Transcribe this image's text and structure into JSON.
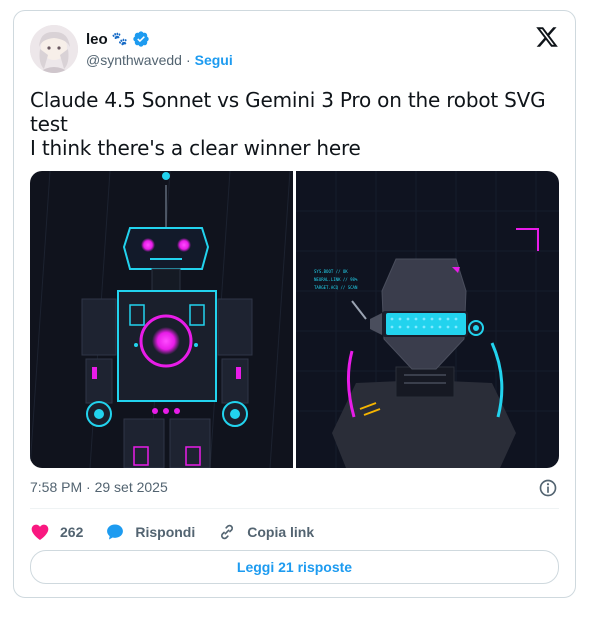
{
  "author": {
    "name": "leo",
    "emoji": "🐾",
    "handle": "@synthwavedd",
    "separator": "·",
    "follow_label": "Segui"
  },
  "tweet": {
    "line1": "Claude 4.5 Sonnet vs Gemini 3 Pro on the robot SVG test",
    "line2": "I think there's a clear winner here"
  },
  "media": {
    "right_readout": [
      "SYS.BOOT // OK",
      "NEURAL.LINK // 98%",
      "TARGET.ACQ // SCAN"
    ]
  },
  "meta": {
    "timestamp": "7:58 PM · 29 set 2025"
  },
  "actions": {
    "likes": "262",
    "reply_label": "Rispondi",
    "copy_link_label": "Copia link"
  },
  "read_replies_label": "Leggi 21 risposte",
  "colors": {
    "like": "#f91880",
    "link_blue": "#1d9bf0",
    "robot_cyan": "#22d3ee",
    "robot_magenta": "#e81ce8",
    "panel_bg": "#0f1320"
  },
  "icons": {
    "verified": "verified-badge-icon",
    "x": "x-logo-icon",
    "info": "info-icon",
    "heart": "heart-icon",
    "reply": "reply-bubble-icon",
    "link": "link-icon"
  }
}
